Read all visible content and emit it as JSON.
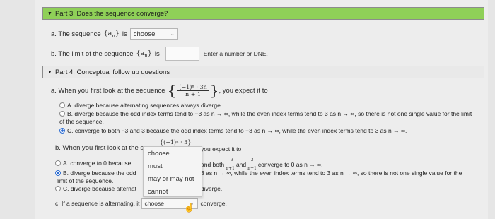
{
  "part3": {
    "header": "Part 3: Does the sequence converge?",
    "a_label": "a. The sequence",
    "a_sym": "{a",
    "a_sub": "n",
    "a_close": "}",
    "a_is": "is",
    "a_select": "choose",
    "b_label": "b. The limit of the sequence",
    "b_sym": "{a",
    "b_sub": "n",
    "b_close": "}",
    "b_is": "is",
    "b_hint": "Enter a number or DNE."
  },
  "part4": {
    "header": "Part 4: Conceptual follow up questions",
    "a_prompt": "a. When you first look at the sequence",
    "a_num": "(−1)ⁿ · 3n",
    "a_den": "n + 1",
    "a_suffix": ", you expect it to",
    "a_opt_a": "A. diverge because alternating sequences always diverge.",
    "a_opt_b": "B. diverge because the odd index terms tend to −3 as n → ∞, while the even index terms tend to 3 as n → ∞, so there is not one single value for the limit of the sequence.",
    "a_opt_c": "C. converge to both −3 and 3 because the odd index terms tend to −3 as n → ∞, while the even index terms tend to 3 as n → ∞.",
    "b_prompt": "b. When you first look at the seq",
    "b_math": "{(−1)ⁿ · 3}",
    "b_suffix": "you expect it to",
    "b_opt_a": "A. converge to 0 because",
    "b_opt_a_right": "and both",
    "b_opt_a_f1": "−3",
    "b_opt_a_and": "and",
    "b_opt_a_f2": "3",
    "b_opt_a_fden": "n+1",
    "b_opt_a_end": "converge to 0 as n → ∞.",
    "b_opt_b": "B. diverge because the odd",
    "b_opt_b2": "limit of the sequence.",
    "b_opt_b_right": "3 as n → ∞, while the even index terms tend to 3 as n → ∞, so there is not one single value for the",
    "b_opt_c": "C. diverge because alternat",
    "b_opt_c_right": "diverge.",
    "c_prompt": "c. If a sequence is alternating, it",
    "c_select": "choose",
    "c_suffix": "converge."
  },
  "dropdown": {
    "options": [
      "choose",
      "must",
      "may or may not",
      "cannot"
    ]
  }
}
